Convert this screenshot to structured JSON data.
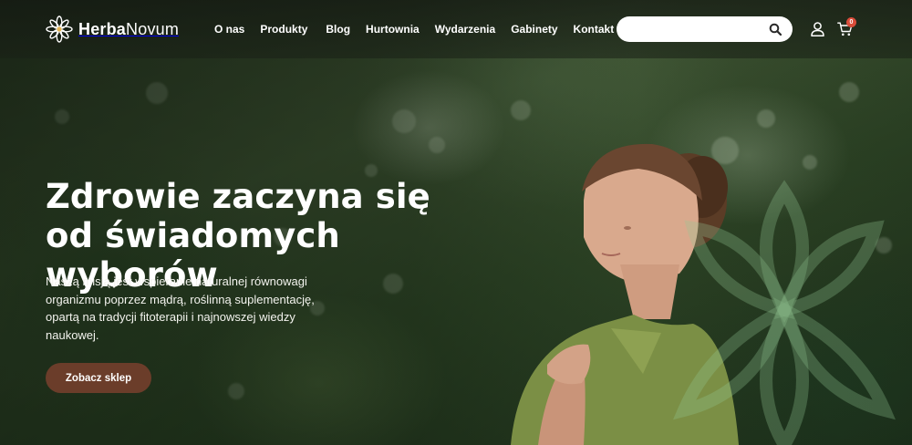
{
  "brand": {
    "name_bold": "Herba",
    "name_light": "Novum"
  },
  "nav": [
    {
      "label": "O nas"
    },
    {
      "label": "Produkty"
    },
    {
      "label": "Blog"
    },
    {
      "label": "Hurtownia"
    },
    {
      "label": "Wydarzenia"
    },
    {
      "label": "Gabinety"
    },
    {
      "label": "Kontakt"
    }
  ],
  "search": {
    "value": "",
    "placeholder": ""
  },
  "cart": {
    "count": "0"
  },
  "hero": {
    "title": "Zdrowie zaczyna się od świadomych wyborów",
    "text": "Naszą misją jest wspieranie naturalnej równowagi organizmu poprzez mądrą, roślinną suplementację, opartą na tradycji fitoterapii i najnowszej wiedzy naukowej.",
    "cta_label": "Zobacz sklep"
  },
  "colors": {
    "accent": "#6b3d2a",
    "badge": "#d94c3a",
    "header_bg": "#1b2118"
  },
  "icons": {
    "logo": "flower-logo-icon",
    "search": "search-icon",
    "user": "user-icon",
    "cart": "cart-icon"
  }
}
